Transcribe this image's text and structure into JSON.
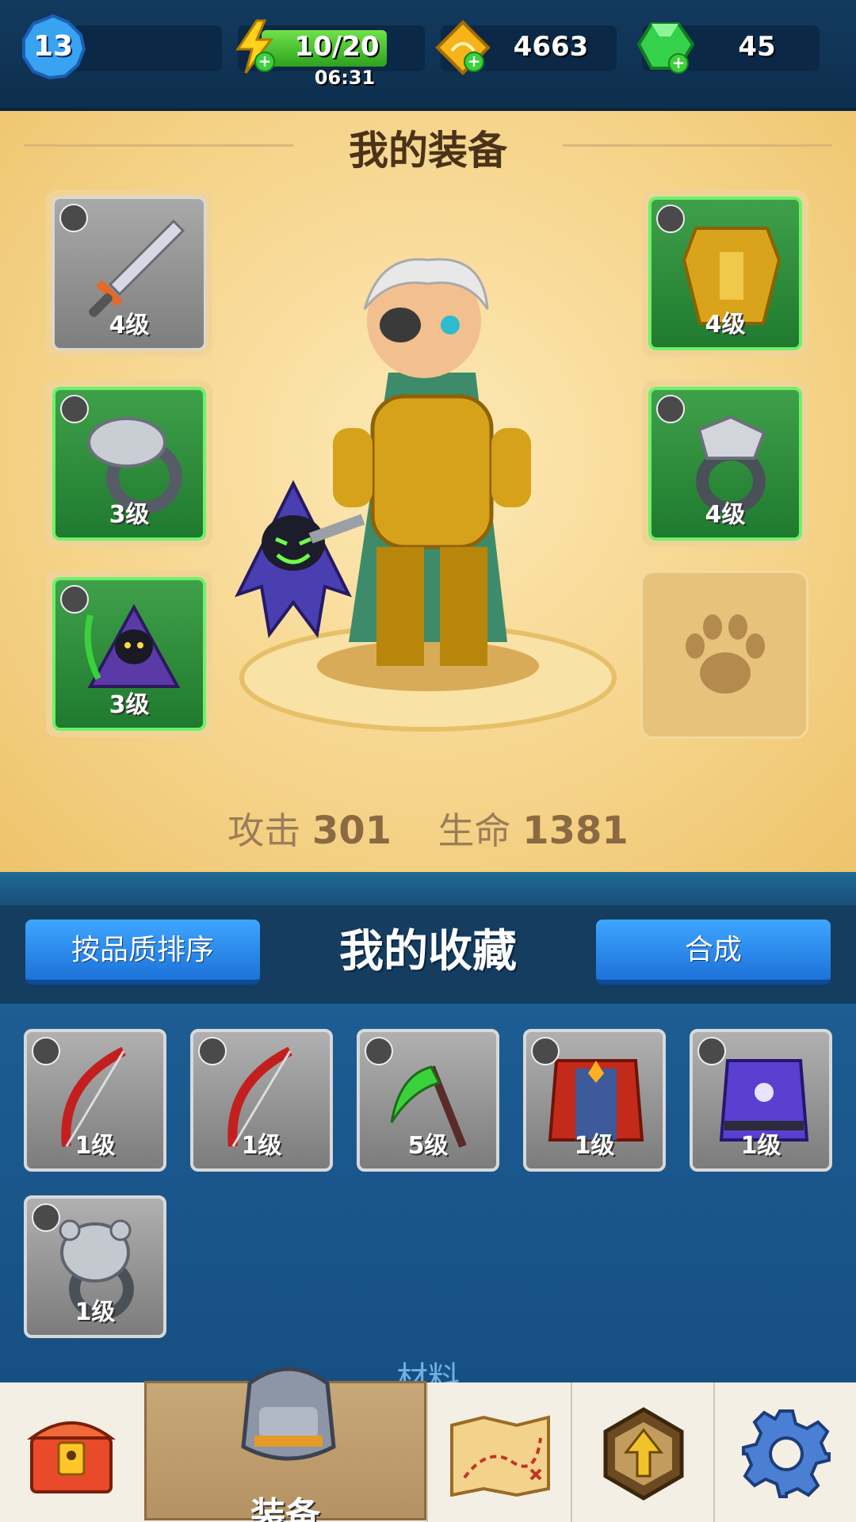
{
  "topbar": {
    "level": "13",
    "energy": "10/20",
    "energy_fill": 0.5,
    "energy_timer": "06:31",
    "gold": "4663",
    "gems": "45"
  },
  "equipment": {
    "title": "我的装备",
    "slots": [
      {
        "icon": "sword-icon",
        "type": "weapon-type-icon",
        "level": "4级",
        "rarity": "gray"
      },
      {
        "icon": "snake-ring-icon",
        "type": "ring-type-icon",
        "level": "3级",
        "rarity": "green"
      },
      {
        "icon": "reaper-pet-icon",
        "type": "pet-type-icon",
        "level": "3级",
        "rarity": "green"
      },
      {
        "icon": "gold-armor-icon",
        "type": "armor-type-icon",
        "level": "4级",
        "rarity": "green"
      },
      {
        "icon": "eagle-ring-icon",
        "type": "ring-type-icon",
        "level": "4级",
        "rarity": "green"
      },
      {
        "icon": "paw-icon",
        "type": "empty-pet-slot",
        "level": "",
        "rarity": "empty"
      }
    ],
    "stats": {
      "attack_label": "攻击",
      "attack_value": "301",
      "hp_label": "生命",
      "hp_value": "1381"
    }
  },
  "collection": {
    "sort_button": "按品质排序",
    "title": "我的收藏",
    "merge_button": "合成",
    "items": [
      {
        "icon": "red-bow-icon",
        "type": "weapon-type-icon",
        "level": "1级"
      },
      {
        "icon": "red-bow-icon",
        "type": "weapon-type-icon",
        "level": "1级"
      },
      {
        "icon": "scythe-icon",
        "type": "weapon-type-icon",
        "level": "5级"
      },
      {
        "icon": "red-robe-icon",
        "type": "armor-type-icon",
        "level": "1级"
      },
      {
        "icon": "purple-vest-icon",
        "type": "armor-type-icon",
        "level": "1级"
      },
      {
        "icon": "bear-ring-icon",
        "type": "ring-type-icon",
        "level": "1级"
      }
    ],
    "materials_label": "材料"
  },
  "nav": {
    "items": [
      {
        "icon": "treasure-chest-icon",
        "label": ""
      },
      {
        "icon": "armor-helmet-icon",
        "label": "装备"
      },
      {
        "icon": "map-icon",
        "label": ""
      },
      {
        "icon": "upgrade-arrow-icon",
        "label": ""
      },
      {
        "icon": "gear-icon",
        "label": ""
      }
    ]
  },
  "colors": {
    "panel_gold": "#f6d58d",
    "rarity_green": "#2e8a3a",
    "rarity_gray": "#8f8f8f",
    "button_blue": "#2f8ff0",
    "background_blue": "#174f82"
  }
}
